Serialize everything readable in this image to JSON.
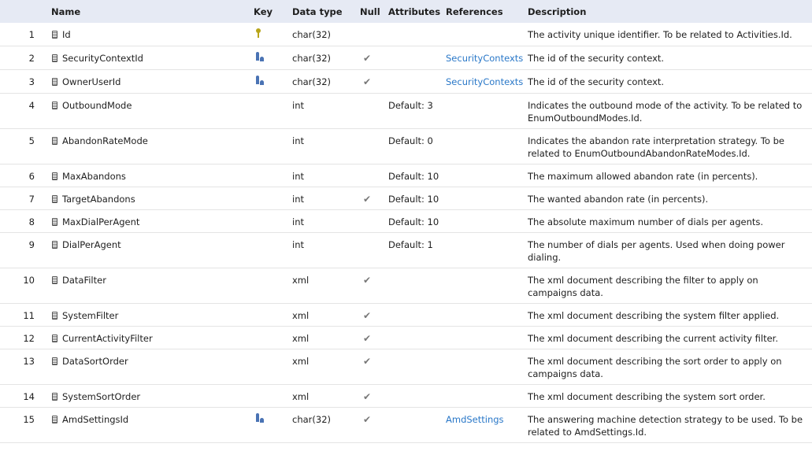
{
  "columns": {
    "name": "Name",
    "key": "Key",
    "data_type": "Data type",
    "null": "Null",
    "attributes": "Attributes",
    "references": "References",
    "description": "Description"
  },
  "rows": [
    {
      "num": "1",
      "name": "Id",
      "key": "primary-key-icon",
      "type": "char(32)",
      "null": "",
      "attr": "",
      "ref": "",
      "desc": "The activity unique identifier. To be related to Activities.Id."
    },
    {
      "num": "2",
      "name": "SecurityContextId",
      "key": "foreign-key-icon",
      "type": "char(32)",
      "null": "✔",
      "attr": "",
      "ref": "SecurityContexts",
      "desc": "The id of the security context."
    },
    {
      "num": "3",
      "name": "OwnerUserId",
      "key": "foreign-key-icon",
      "type": "char(32)",
      "null": "✔",
      "attr": "",
      "ref": "SecurityContexts",
      "desc": "The id of the security context."
    },
    {
      "num": "4",
      "name": "OutboundMode",
      "key": "",
      "type": "int",
      "null": "",
      "attr": "Default: 3",
      "ref": "",
      "desc": "Indicates the outbound mode of the activity. To be related to EnumOutboundModes.Id."
    },
    {
      "num": "5",
      "name": "AbandonRateMode",
      "key": "",
      "type": "int",
      "null": "",
      "attr": "Default: 0",
      "ref": "",
      "desc": "Indicates the abandon rate interpretation strategy. To be related to EnumOutboundAbandonRateModes.Id."
    },
    {
      "num": "6",
      "name": "MaxAbandons",
      "key": "",
      "type": "int",
      "null": "",
      "attr": "Default: 10",
      "ref": "",
      "desc": "The maximum allowed abandon rate (in percents)."
    },
    {
      "num": "7",
      "name": "TargetAbandons",
      "key": "",
      "type": "int",
      "null": "✔",
      "attr": "Default: 10",
      "ref": "",
      "desc": "The wanted abandon rate (in percents)."
    },
    {
      "num": "8",
      "name": "MaxDialPerAgent",
      "key": "",
      "type": "int",
      "null": "",
      "attr": "Default: 10",
      "ref": "",
      "desc": "The absolute maximum number of dials per agents."
    },
    {
      "num": "9",
      "name": "DialPerAgent",
      "key": "",
      "type": "int",
      "null": "",
      "attr": "Default: 1",
      "ref": "",
      "desc": "The number of dials per agents. Used when doing power dialing."
    },
    {
      "num": "10",
      "name": "DataFilter",
      "key": "",
      "type": "xml",
      "null": "✔",
      "attr": "",
      "ref": "",
      "desc": "The xml document describing the filter to apply on campaigns data."
    },
    {
      "num": "11",
      "name": "SystemFilter",
      "key": "",
      "type": "xml",
      "null": "✔",
      "attr": "",
      "ref": "",
      "desc": "The xml document describing the system filter applied."
    },
    {
      "num": "12",
      "name": "CurrentActivityFilter",
      "key": "",
      "type": "xml",
      "null": "✔",
      "attr": "",
      "ref": "",
      "desc": "The xml document describing the current activity filter."
    },
    {
      "num": "13",
      "name": "DataSortOrder",
      "key": "",
      "type": "xml",
      "null": "✔",
      "attr": "",
      "ref": "",
      "desc": "The xml document describing the sort order to apply on campaigns data."
    },
    {
      "num": "14",
      "name": "SystemSortOrder",
      "key": "",
      "type": "xml",
      "null": "✔",
      "attr": "",
      "ref": "",
      "desc": "The xml document describing the system sort order."
    },
    {
      "num": "15",
      "name": "AmdSettingsId",
      "key": "foreign-key-icon",
      "type": "char(32)",
      "null": "✔",
      "attr": "",
      "ref": "AmdSettings",
      "desc": "The answering machine detection strategy to be used. To be related to AmdSettings.Id."
    }
  ]
}
